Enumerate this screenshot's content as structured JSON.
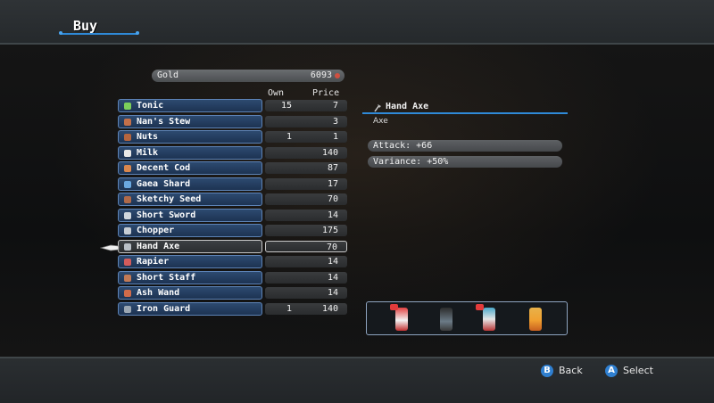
{
  "header": {
    "title": "Buy"
  },
  "gold": {
    "label": "Gold",
    "value": "6093"
  },
  "columns": {
    "own": "Own",
    "price": "Price"
  },
  "items": [
    {
      "name": "Tonic",
      "own": "15",
      "price": "7",
      "icon": "potion-icon"
    },
    {
      "name": "Nan's Stew",
      "own": "",
      "price": "3",
      "icon": "stew-icon"
    },
    {
      "name": "Nuts",
      "own": "1",
      "price": "1",
      "icon": "nuts-icon"
    },
    {
      "name": "Milk",
      "own": "",
      "price": "140",
      "icon": "milk-icon"
    },
    {
      "name": "Decent Cod",
      "own": "",
      "price": "87",
      "icon": "fish-icon"
    },
    {
      "name": "Gaea Shard",
      "own": "",
      "price": "17",
      "icon": "shard-icon"
    },
    {
      "name": "Sketchy Seed",
      "own": "",
      "price": "70",
      "icon": "seed-icon"
    },
    {
      "name": "Short Sword",
      "own": "",
      "price": "14",
      "icon": "sword-icon"
    },
    {
      "name": "Chopper",
      "own": "",
      "price": "175",
      "icon": "chopper-icon"
    },
    {
      "name": "Hand Axe",
      "own": "",
      "price": "70",
      "icon": "axe-icon"
    },
    {
      "name": "Rapier",
      "own": "",
      "price": "14",
      "icon": "rapier-icon"
    },
    {
      "name": "Short Staff",
      "own": "",
      "price": "14",
      "icon": "staff-icon"
    },
    {
      "name": "Ash Wand",
      "own": "",
      "price": "14",
      "icon": "wand-icon"
    },
    {
      "name": "Iron Guard",
      "own": "1",
      "price": "140",
      "icon": "armor-icon"
    }
  ],
  "detail": {
    "name": "Hand Axe",
    "type": "Axe",
    "attack": "Attack:  +66",
    "variance": "Variance:  +50%"
  },
  "footer": {
    "back_glyph": "B",
    "back_label": "Back",
    "select_glyph": "A",
    "select_label": "Select"
  },
  "colors": {
    "accent": "#2f8ad8",
    "row_fill": "#2d4a70",
    "row_border": "#5d83b6"
  }
}
